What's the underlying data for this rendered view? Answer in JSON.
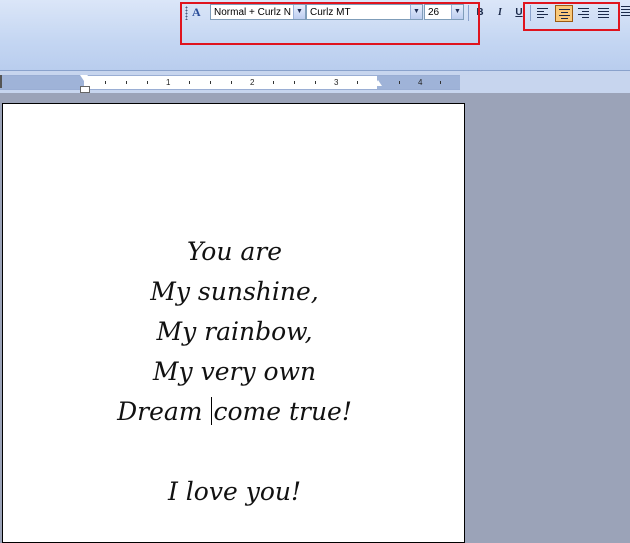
{
  "toolbar": {
    "style_value": "Normal + Curlz N",
    "font_value": "Curlz MT",
    "size_value": "26",
    "bold_label": "B",
    "italic_label": "I",
    "underline_label": "U",
    "align_active": "center",
    "highlight_color": "#e0141e",
    "active_button_color": "#f9c97a"
  },
  "ruler": {
    "numbers": [
      "1",
      "2",
      "3",
      "4"
    ]
  },
  "document": {
    "lines": [
      "You are",
      "My sunshine,",
      "My rainbow,",
      "My very own"
    ],
    "line5_before": "Dream ",
    "line5_after": "come true!",
    "closing": "I love you!"
  }
}
